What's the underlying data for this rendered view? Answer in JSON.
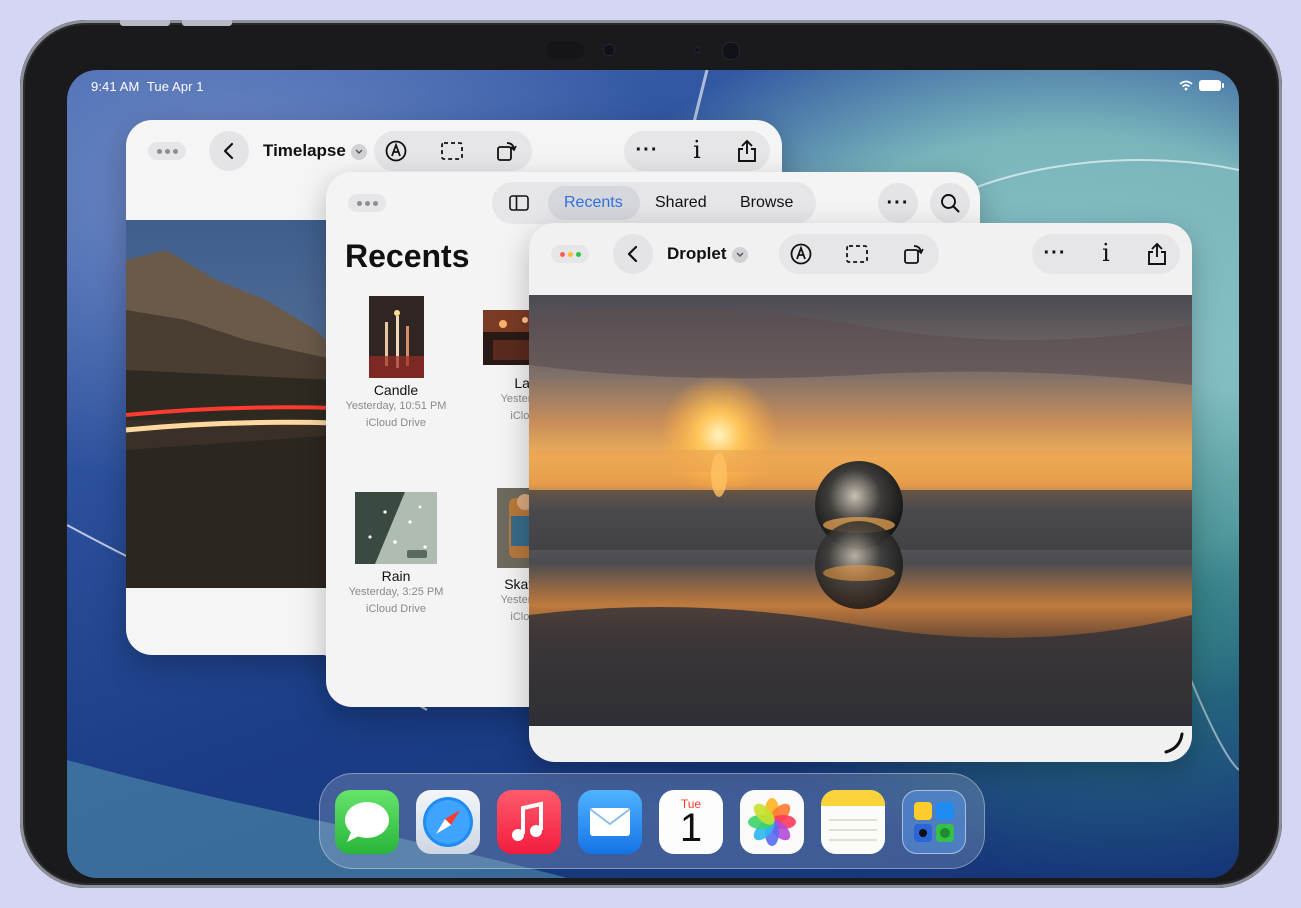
{
  "status_bar": {
    "time": "9:41 AM",
    "date": "Tue Apr 1"
  },
  "window_timelapse": {
    "title": "Timelapse"
  },
  "window_files": {
    "tabs": [
      "Recents",
      "Shared",
      "Browse"
    ],
    "active_tab": "Recents",
    "heading": "Recents",
    "files": [
      {
        "name": "Candle",
        "date": "Yesterday, 10:51 PM",
        "location": "iCloud Drive"
      },
      {
        "name": "Lan",
        "date": "Yesterday,",
        "location": "iCloud"
      },
      {
        "name": "Rain",
        "date": "Yesterday, 3:25 PM",
        "location": "iCloud Drive"
      },
      {
        "name": "Skateb",
        "date": "Yesterday,",
        "location": "iCloud"
      }
    ]
  },
  "window_droplet": {
    "title": "Droplet"
  },
  "toolbar": {
    "more": "···",
    "info": "i"
  },
  "dock": {
    "apps": [
      "Messages",
      "Safari",
      "Music",
      "Mail",
      "Calendar",
      "Photos",
      "Notes",
      "Folder"
    ],
    "calendar_day": "Tue",
    "calendar_date": "1"
  },
  "colors": {
    "accent": "#2f6fdd",
    "wallpaper": "#2b4f9b"
  }
}
